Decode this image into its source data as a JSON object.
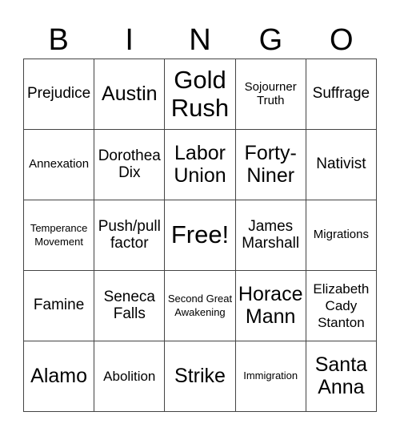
{
  "header": [
    "B",
    "I",
    "N",
    "G",
    "O"
  ],
  "cells": [
    {
      "label": "Prejudice",
      "size": "s-m"
    },
    {
      "label": "Austin",
      "size": "s-l"
    },
    {
      "label": "Gold Rush",
      "size": "s-xl"
    },
    {
      "label": "Sojourner Truth",
      "size": "s-xs"
    },
    {
      "label": "Suffrage",
      "size": "s-m"
    },
    {
      "label": "Annexation",
      "size": "s-xs"
    },
    {
      "label": "Dorothea Dix",
      "size": "s-m"
    },
    {
      "label": "Labor Union",
      "size": "s-l"
    },
    {
      "label": "Forty-Niner",
      "size": "s-l"
    },
    {
      "label": "Nativist",
      "size": "s-m"
    },
    {
      "label": "Temperance Movement",
      "size": "s-xxs"
    },
    {
      "label": "Push/pull factor",
      "size": "s-m"
    },
    {
      "label": "Free!",
      "size": "s-free"
    },
    {
      "label": "James Marshall",
      "size": "s-m"
    },
    {
      "label": "Migrations",
      "size": "s-xs"
    },
    {
      "label": "Famine",
      "size": "s-m"
    },
    {
      "label": "Seneca Falls",
      "size": "s-m"
    },
    {
      "label": "Second Great Awakening",
      "size": "s-xxs"
    },
    {
      "label": "Horace Mann",
      "size": "s-l"
    },
    {
      "label": "Elizabeth Cady Stanton",
      "size": "s-s"
    },
    {
      "label": "Alamo",
      "size": "s-l"
    },
    {
      "label": "Abolition",
      "size": "s-s"
    },
    {
      "label": "Strike",
      "size": "s-l"
    },
    {
      "label": "Immigration",
      "size": "s-xxs"
    },
    {
      "label": "Santa Anna",
      "size": "s-l"
    }
  ]
}
